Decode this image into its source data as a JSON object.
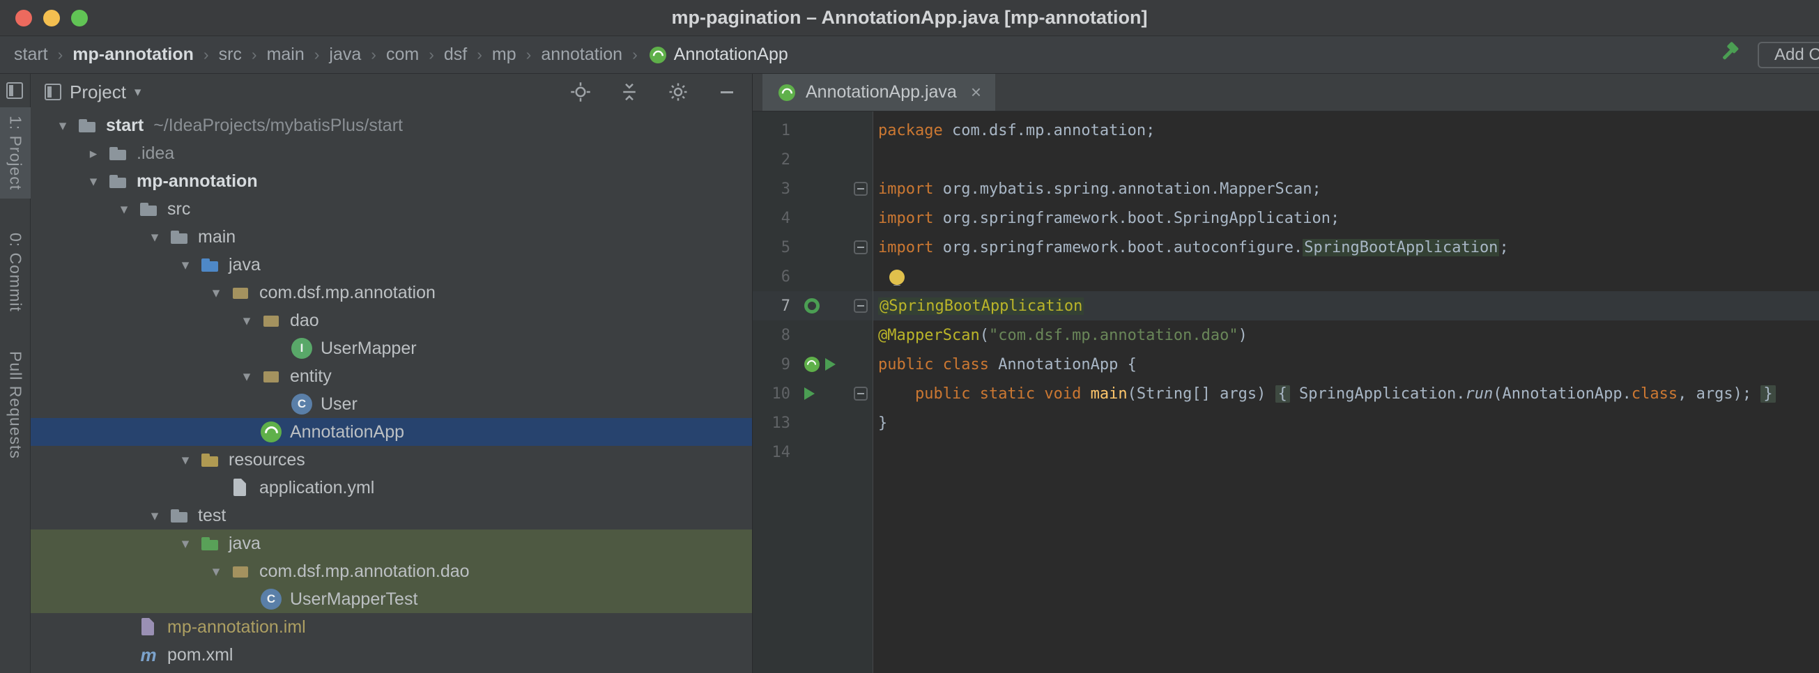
{
  "window": {
    "title": "mp-pagination – AnnotationApp.java [mp-annotation]"
  },
  "colors": {
    "selection_blue": "#27436e",
    "test_scope_green": "#4e5942",
    "keyword_orange": "#cc7832",
    "string_green": "#6a8759",
    "annotation_yellow": "#bbb529",
    "method_gold": "#ffc66b",
    "spring_green": "#5fb04a",
    "run_green": "#4b9e53",
    "editor_bg": "#2b2b2b",
    "panel_bg": "#3c3f41"
  },
  "navbar": {
    "breadcrumbs": [
      {
        "label": "start"
      },
      {
        "label": "mp-annotation",
        "emphasis": true,
        "bold": true
      },
      {
        "label": "src"
      },
      {
        "label": "main"
      },
      {
        "label": "java"
      },
      {
        "label": "com"
      },
      {
        "label": "dsf"
      },
      {
        "label": "mp"
      },
      {
        "label": "annotation"
      },
      {
        "label": "AnnotationApp",
        "icon": "spring-boot",
        "emphasis": true
      }
    ],
    "add_configuration_label": "Add Co"
  },
  "tool_stripe": {
    "items": [
      {
        "label": "1: Project",
        "active": true
      },
      {
        "label": "0: Commit"
      },
      {
        "label": "Pull Requests"
      }
    ]
  },
  "project_panel": {
    "title": "Project",
    "tree": [
      {
        "label": "start",
        "suffix": "~/IdeaProjects/mybatisPlus/start",
        "indent": 0,
        "icon": "project-folder",
        "state": "expanded",
        "style": "bold"
      },
      {
        "label": ".idea",
        "indent": 1,
        "icon": "folder",
        "state": "collapsed",
        "style": "dim"
      },
      {
        "label": "mp-annotation",
        "indent": 1,
        "icon": "module-folder",
        "state": "expanded",
        "style": "bold"
      },
      {
        "label": "src",
        "indent": 2,
        "icon": "folder",
        "state": "expanded"
      },
      {
        "label": "main",
        "indent": 3,
        "icon": "folder",
        "state": "expanded"
      },
      {
        "label": "java",
        "indent": 4,
        "icon": "source-folder",
        "state": "expanded"
      },
      {
        "label": "com.dsf.mp.annotation",
        "indent": 5,
        "icon": "package",
        "state": "expanded"
      },
      {
        "label": "dao",
        "indent": 6,
        "icon": "package",
        "state": "expanded"
      },
      {
        "label": "UserMapper",
        "indent": 7,
        "icon": "interface"
      },
      {
        "label": "entity",
        "indent": 6,
        "icon": "package",
        "state": "expanded"
      },
      {
        "label": "User",
        "indent": 7,
        "icon": "class"
      },
      {
        "label": "AnnotationApp",
        "indent": 6,
        "icon": "spring-boot",
        "selected": true
      },
      {
        "label": "resources",
        "indent": 4,
        "icon": "resources-folder",
        "state": "expanded"
      },
      {
        "label": "application.yml",
        "indent": 5,
        "icon": "yaml-file"
      },
      {
        "label": "test",
        "indent": 3,
        "icon": "folder",
        "state": "expanded"
      },
      {
        "label": "java",
        "indent": 4,
        "icon": "test-folder",
        "state": "expanded",
        "highlight": "test"
      },
      {
        "label": "com.dsf.mp.annotation.dao",
        "indent": 5,
        "icon": "package",
        "state": "expanded",
        "highlight": "test"
      },
      {
        "label": "UserMapperTest",
        "indent": 6,
        "icon": "class",
        "highlight": "test"
      },
      {
        "label": "mp-annotation.iml",
        "indent": 2,
        "icon": "iml-file",
        "style": "iml"
      },
      {
        "label": "pom.xml",
        "indent": 2,
        "icon": "maven-file"
      }
    ]
  },
  "editor": {
    "tab": {
      "label": "AnnotationApp.java",
      "icon": "spring-boot",
      "close": "×"
    },
    "lines": [
      {
        "num": "1",
        "segs": [
          {
            "t": "package ",
            "c": "kw"
          },
          {
            "t": "com.dsf.mp.annotation;",
            "c": "pl"
          }
        ]
      },
      {
        "num": "2",
        "segs": []
      },
      {
        "num": "3",
        "fold": true,
        "segs": [
          {
            "t": "import ",
            "c": "kw"
          },
          {
            "t": "org.mybatis.spring.annotation.MapperScan;",
            "c": "pl"
          }
        ]
      },
      {
        "num": "4",
        "segs": [
          {
            "t": "import ",
            "c": "kw"
          },
          {
            "t": "org.springframework.boot.SpringApplication;",
            "c": "pl"
          }
        ]
      },
      {
        "num": "5",
        "fold": true,
        "segs": [
          {
            "t": "import ",
            "c": "kw"
          },
          {
            "t": "org.springframework.boot.autoconfigure.",
            "c": "pl"
          },
          {
            "t": "SpringBootApplication",
            "c": "pl hl"
          },
          {
            "t": ";",
            "c": "pl"
          }
        ]
      },
      {
        "num": "6",
        "bulb": true,
        "segs": []
      },
      {
        "num": "7",
        "fold": true,
        "current": true,
        "gutter": [
          "rerun"
        ],
        "segs": [
          {
            "t": "@SpringBootApplication",
            "c": "ann hl"
          }
        ]
      },
      {
        "num": "8",
        "segs": [
          {
            "t": "@MapperScan",
            "c": "ann"
          },
          {
            "t": "(",
            "c": "pl"
          },
          {
            "t": "\"com.dsf.mp.annotation.dao\"",
            "c": "str"
          },
          {
            "t": ")",
            "c": "pl"
          }
        ]
      },
      {
        "num": "9",
        "gutter": [
          "spring",
          "run"
        ],
        "segs": [
          {
            "t": "public class ",
            "c": "kw"
          },
          {
            "t": "AnnotationApp {",
            "c": "pl"
          }
        ]
      },
      {
        "num": "10",
        "fold": true,
        "gutter": [
          "run"
        ],
        "segs": [
          {
            "t": "    ",
            "c": "pl"
          },
          {
            "t": "public static void ",
            "c": "kw"
          },
          {
            "t": "main",
            "c": "mth"
          },
          {
            "t": "(String[] args) ",
            "c": "pl"
          },
          {
            "t": "{",
            "c": "pl foldbg"
          },
          {
            "t": " SpringApplication.",
            "c": "pl"
          },
          {
            "t": "run",
            "c": "pl it"
          },
          {
            "t": "(AnnotationApp.",
            "c": "pl"
          },
          {
            "t": "class",
            "c": "kw"
          },
          {
            "t": ", args); ",
            "c": "pl"
          },
          {
            "t": "}",
            "c": "pl foldbg"
          }
        ]
      },
      {
        "num": "13",
        "segs": [
          {
            "t": "}",
            "c": "pl"
          }
        ]
      },
      {
        "num": "14",
        "segs": []
      }
    ]
  }
}
